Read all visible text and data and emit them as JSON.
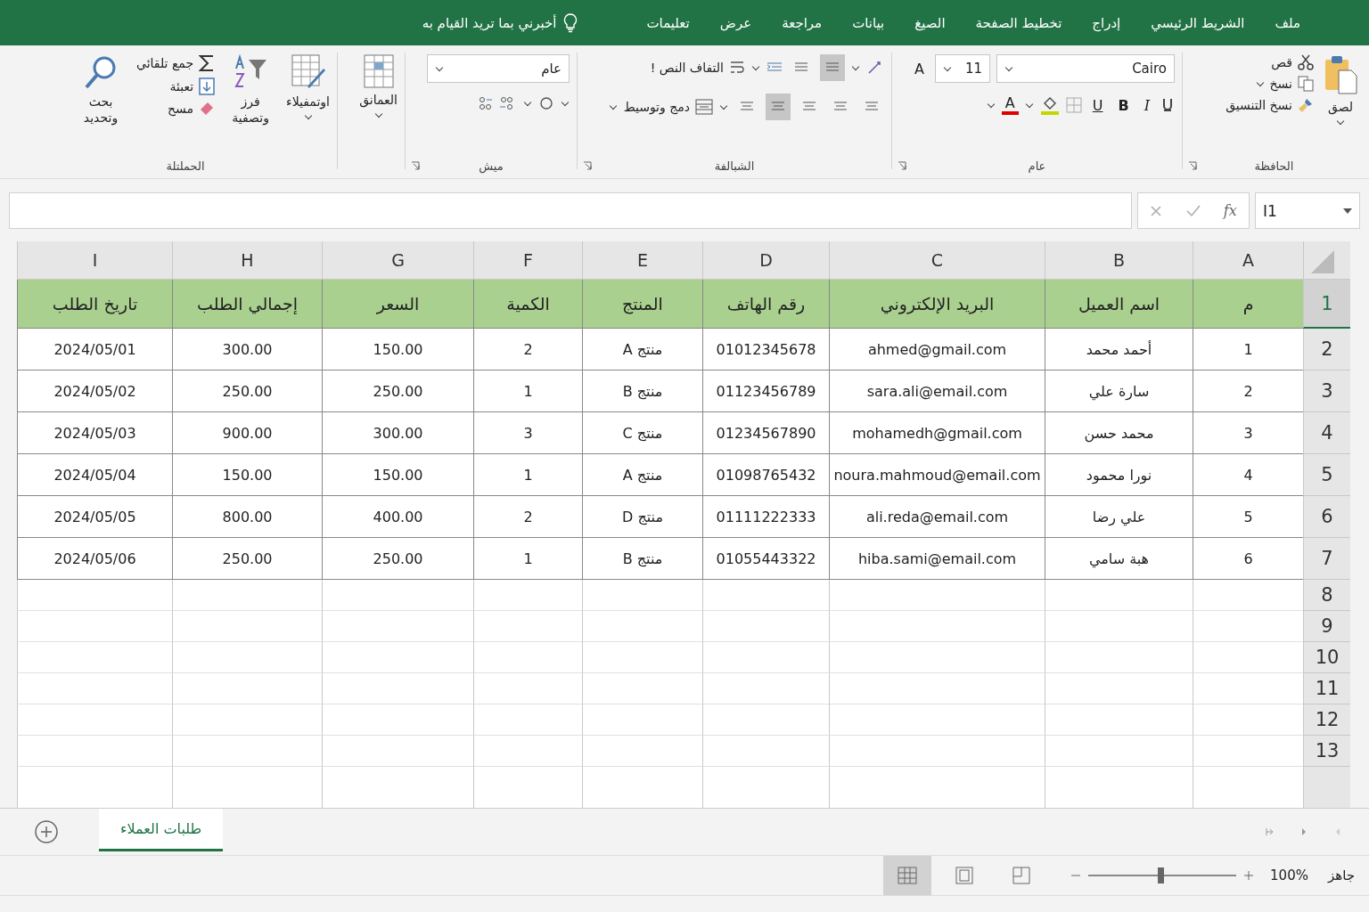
{
  "ribbon_tabs": [
    "ملف",
    "الشريط الرئيسي",
    "إدراج",
    "تخطيط الصفحة",
    "الصيغ",
    "بيانات",
    "مراجعة",
    "عرض",
    "تعليمات"
  ],
  "tell_me": "أخبرني بما تريد القيام به",
  "clipboard": {
    "paste": "لصق",
    "cut": "قص",
    "copy": "نسخ",
    "format_painter": "نسخ التنسيق",
    "label": "الحافظة"
  },
  "font": {
    "name": "Cairo",
    "size": "11",
    "grow": "A",
    "underline": "U",
    "bold": "B",
    "italic": "I",
    "color_letter": "A",
    "label": "عام"
  },
  "alignment": {
    "wrap_text": "التفاف النص !",
    "merge": "دمج وتوسيط",
    "label": "الشبالفة",
    "top_buttons": [
      {
        "selected": true
      },
      {
        "selected": false
      }
    ],
    "bottom_buttons": [
      {
        "selected": false
      },
      {
        "selected": false
      },
      {
        "selected": false
      },
      {
        "selected": true
      },
      {
        "selected": false
      }
    ]
  },
  "number": {
    "format": "عام",
    "label": "ميش"
  },
  "cells": {
    "button": "العمانق"
  },
  "editing": {
    "conditional": "اوتمفيلاء",
    "sort": "فرز وتصفية",
    "autosum": "جمع تلقائي",
    "fill": "تعبئة",
    "clear": "مسح",
    "find": "بحث وتحديد",
    "label": "الحملتلة"
  },
  "formula_bar": {
    "name_box": "I1",
    "fx": "fx"
  },
  "columns": [
    "A",
    "B",
    "C",
    "D",
    "E",
    "F",
    "G",
    "H",
    "I"
  ],
  "header_row": {
    "number": "1",
    "cells": [
      "م",
      "اسم العميل",
      "البريد الإلكتروني",
      "رقم الهاتف",
      "المنتج",
      "الكمية",
      "السعر",
      "إجمالي الطلب",
      "تاريخ الطلب"
    ]
  },
  "rows": [
    {
      "number": "2",
      "cells": [
        "1",
        "أحمد محمد",
        "ahmed@gmail.com",
        "01012345678",
        "منتج A",
        "2",
        "150.00",
        "300.00",
        "2024/05/01"
      ]
    },
    {
      "number": "3",
      "cells": [
        "2",
        "سارة علي",
        "sara.ali@email.com",
        "01123456789",
        "منتج B",
        "1",
        "250.00",
        "250.00",
        "2024/05/02"
      ]
    },
    {
      "number": "4",
      "cells": [
        "3",
        "محمد حسن",
        "mohamedh@gmail.com",
        "01234567890",
        "منتج C",
        "3",
        "300.00",
        "900.00",
        "2024/05/03"
      ]
    },
    {
      "number": "5",
      "cells": [
        "4",
        "نورا محمود",
        "noura.mahmoud@email.com",
        "01098765432",
        "منتج A",
        "1",
        "150.00",
        "150.00",
        "2024/05/04"
      ]
    },
    {
      "number": "6",
      "cells": [
        "5",
        "علي رضا",
        "ali.reda@email.com",
        "01111222333",
        "منتج D",
        "2",
        "400.00",
        "800.00",
        "2024/05/05"
      ]
    },
    {
      "number": "7",
      "cells": [
        "6",
        "هبة سامي",
        "hiba.sami@email.com",
        "01055443322",
        "منتج B",
        "1",
        "250.00",
        "250.00",
        "2024/05/06"
      ]
    }
  ],
  "empty_rows": [
    "8",
    "9",
    "10",
    "11",
    "12",
    "13"
  ],
  "sheet_tabs": [
    {
      "label": "طلبات العملاء",
      "selected": true
    }
  ],
  "status_bar": {
    "ready": "جاهز",
    "zoom": "100%",
    "zoom_slider": {
      "level": 0.49
    },
    "views": [
      {
        "selected": true
      },
      {
        "selected": false
      },
      {
        "selected": false
      }
    ]
  }
}
